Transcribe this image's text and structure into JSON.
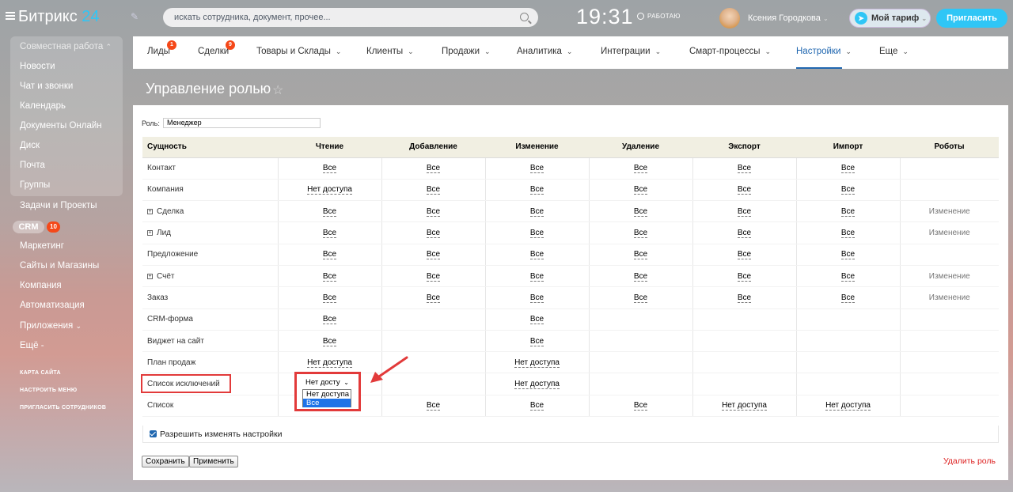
{
  "header": {
    "logo_main": "Битрикс",
    "logo_num": "24",
    "search_placeholder": "искать сотрудника, документ, прочее...",
    "time": "19:31",
    "work_status": "РАБОТАЮ",
    "user_name": "Ксения Городкова",
    "tariff": "Мой тариф",
    "invite": "Пригласить"
  },
  "sidebar": {
    "group_title": "Совместная работа",
    "items": [
      "Новости",
      "Чат и звонки",
      "Календарь",
      "Документы Онлайн",
      "Диск",
      "Почта",
      "Группы",
      "Задачи и Проекты"
    ],
    "crm": "CRM",
    "crm_count": "10",
    "items2": [
      "Маркетинг",
      "Сайты и Магазины",
      "Компания",
      "Автоматизация",
      "Приложения",
      "Ещё"
    ],
    "links": [
      "КАРТА САЙТА",
      "НАСТРОИТЬ МЕНЮ",
      "ПРИГЛАСИТЬ СОТРУДНИКОВ"
    ]
  },
  "nav": {
    "tabs": [
      "Лиды",
      "Сделки",
      "Товары и Склады",
      "Клиенты",
      "Продажи",
      "Аналитика",
      "Интеграции",
      "Смарт-процессы",
      "Настройки",
      "Еще"
    ],
    "badge_leads": "1",
    "badge_deals": "9"
  },
  "page": {
    "title": "Управление ролью",
    "role_label": "Роль:",
    "role_value": "Менеджер",
    "allow_label": "Разрешить изменять настройки",
    "save": "Сохранить",
    "apply": "Применить",
    "delete": "Удалить роль"
  },
  "table": {
    "headers": [
      "Сущность",
      "Чтение",
      "Добавление",
      "Изменение",
      "Удаление",
      "Экспорт",
      "Импорт",
      "Роботы"
    ],
    "rows": [
      {
        "name": "Контакт",
        "expand": false,
        "cells": [
          "Все",
          "Все",
          "Все",
          "Все",
          "Все",
          "Все",
          ""
        ]
      },
      {
        "name": "Компания",
        "expand": false,
        "cells": [
          "Нет доступа",
          "Все",
          "Все",
          "Все",
          "Все",
          "Все",
          ""
        ]
      },
      {
        "name": "Сделка",
        "expand": true,
        "cells": [
          "Все",
          "Все",
          "Все",
          "Все",
          "Все",
          "Все",
          "Изменение"
        ]
      },
      {
        "name": "Лид",
        "expand": true,
        "cells": [
          "Все",
          "Все",
          "Все",
          "Все",
          "Все",
          "Все",
          "Изменение"
        ]
      },
      {
        "name": "Предложение",
        "expand": false,
        "cells": [
          "Все",
          "Все",
          "Все",
          "Все",
          "Все",
          "Все",
          ""
        ]
      },
      {
        "name": "Счёт",
        "expand": true,
        "cells": [
          "Все",
          "Все",
          "Все",
          "Все",
          "Все",
          "Все",
          "Изменение"
        ]
      },
      {
        "name": "Заказ",
        "expand": false,
        "cells": [
          "Все",
          "Все",
          "Все",
          "Все",
          "Все",
          "Все",
          "Изменение"
        ]
      },
      {
        "name": "CRM-форма",
        "expand": false,
        "cells": [
          "Все",
          "",
          "Все",
          "",
          "",
          "",
          ""
        ]
      },
      {
        "name": "Виджет на сайт",
        "expand": false,
        "cells": [
          "Все",
          "",
          "Все",
          "",
          "",
          "",
          ""
        ]
      },
      {
        "name": "План продаж",
        "expand": false,
        "cells": [
          "Нет доступа",
          "",
          "Нет доступа",
          "",
          "",
          "",
          ""
        ]
      },
      {
        "name": "Список исключений",
        "expand": false,
        "cells": [
          "",
          "",
          "Нет доступа",
          "",
          "",
          "",
          ""
        ]
      },
      {
        "name": "Список",
        "expand": false,
        "cells": [
          "",
          "Все",
          "Все",
          "Все",
          "Нет доступа",
          "Нет доступа",
          ""
        ]
      }
    ]
  },
  "dropdown": {
    "value": "Нет досту",
    "options": [
      "Нет доступа",
      "Все"
    ]
  },
  "colors": {
    "accent": "#2fc6f6",
    "highlight": "#e23a3a",
    "active_tab": "#2067b0"
  }
}
